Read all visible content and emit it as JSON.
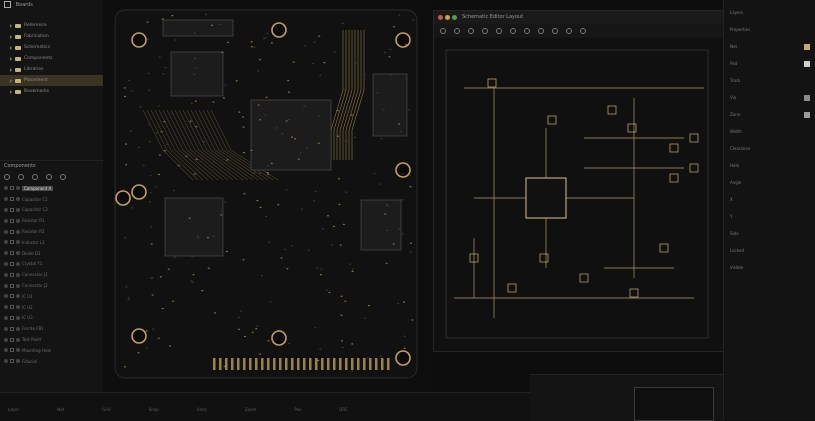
{
  "left_top": {
    "title": "Boards",
    "items": [
      {
        "label": "Reference"
      },
      {
        "label": "Fabrication"
      },
      {
        "label": "Schematics"
      },
      {
        "label": "Components"
      },
      {
        "label": "Libraries"
      },
      {
        "label": "Placement"
      },
      {
        "label": "Bookmarks"
      }
    ],
    "selected_index": 5
  },
  "left_bottom": {
    "title": "Components",
    "rows": [
      {
        "label": "Component A"
      },
      {
        "label": "Capacitor C1"
      },
      {
        "label": "Capacitor C2"
      },
      {
        "label": "Resistor R1"
      },
      {
        "label": "Resistor R2"
      },
      {
        "label": "Inductor L1"
      },
      {
        "label": "Diode D1"
      },
      {
        "label": "Crystal Y1"
      },
      {
        "label": "Connector J1"
      },
      {
        "label": "Connector J2"
      },
      {
        "label": "IC U1"
      },
      {
        "label": "IC U2"
      },
      {
        "label": "IC U3"
      },
      {
        "label": "Ferrite FB1"
      },
      {
        "label": "Test Point"
      },
      {
        "label": "Mounting Hole"
      },
      {
        "label": "Fiducial"
      }
    ],
    "selected_index": 0
  },
  "schematic": {
    "title": "Schematic Editor Layout"
  },
  "right_panel": {
    "rows": [
      {
        "label": "Layers",
        "swatch": ""
      },
      {
        "label": "Properties",
        "swatch": ""
      },
      {
        "label": "Net",
        "swatch": "#c9a96b"
      },
      {
        "label": "Pad",
        "swatch": "#cfcfcf"
      },
      {
        "label": "Track",
        "swatch": ""
      },
      {
        "label": "Via",
        "swatch": "#8c8c8c"
      },
      {
        "label": "Zone",
        "swatch": "#9a9a9a"
      },
      {
        "label": "Width",
        "swatch": ""
      },
      {
        "label": "Clearance",
        "swatch": ""
      },
      {
        "label": "Hole",
        "swatch": ""
      },
      {
        "label": "Angle",
        "swatch": ""
      },
      {
        "label": "X",
        "swatch": ""
      },
      {
        "label": "Y",
        "swatch": ""
      },
      {
        "label": "Side",
        "swatch": ""
      },
      {
        "label": "Locked",
        "swatch": ""
      },
      {
        "label": "Visible",
        "swatch": ""
      }
    ]
  },
  "bottom": {
    "items": [
      "Layer",
      "Net",
      "Grid",
      "Snap",
      "Units",
      "Zoom",
      "Pos",
      "DRC"
    ]
  },
  "colors": {
    "gold": "#c9a96b",
    "panel": "#141414",
    "selected": "#3a3423"
  }
}
